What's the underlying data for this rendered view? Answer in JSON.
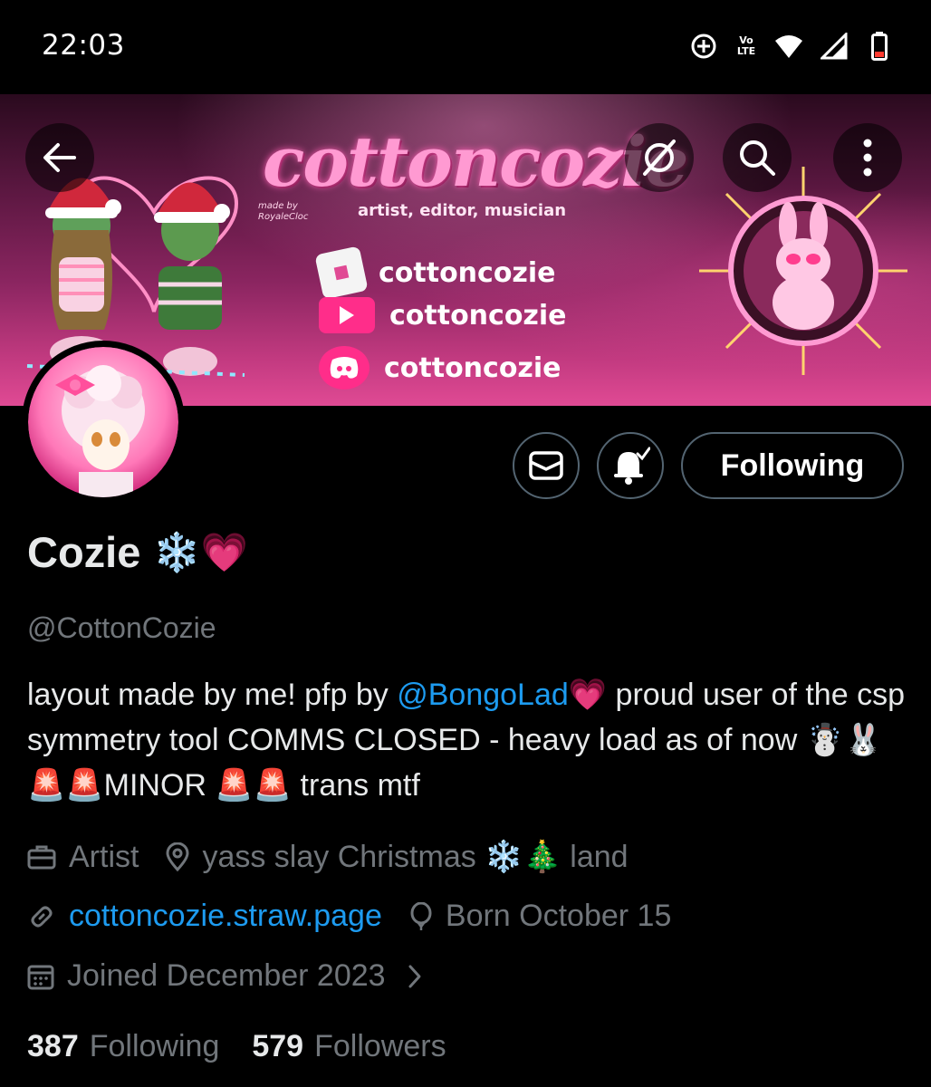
{
  "status_bar": {
    "time": "22:03",
    "icons": [
      "data-saver-icon",
      "volte-icon",
      "wifi-icon",
      "signal-icon",
      "battery-icon"
    ],
    "volte_label": "Vo LTE"
  },
  "banner": {
    "title": "cottoncozie",
    "subtitle": "artist, editor, musician",
    "credit": "made by RoyaleCloc",
    "socials": [
      {
        "icon": "roblox-icon",
        "label": "cottoncozie",
        "color": "#f4f4f4"
      },
      {
        "icon": "youtube-icon",
        "label": "cottoncozie",
        "color": "#ff2d8a"
      },
      {
        "icon": "discord-icon",
        "label": "cottoncozie",
        "color": "#ff2d8a"
      }
    ]
  },
  "nav": {
    "back": "back-arrow-icon",
    "grok": "grok-icon",
    "search": "search-icon",
    "more": "more-vertical-icon"
  },
  "actions": {
    "message_icon": "envelope-icon",
    "notify_icon": "bell-check-icon",
    "follow_label": "Following"
  },
  "profile": {
    "name": "Cozie",
    "name_emoji": "❄️💗",
    "handle": "@CottonCozie",
    "bio_part1": "layout made by me! pfp by ",
    "bio_mention": "@BongoLad",
    "bio_part2": "💗 proud user of the csp symmetry tool COMMS CLOSED - heavy load as of now ☃️🐰 🚨🚨MINOR 🚨🚨 trans mtf",
    "profession": "Artist",
    "location": "yass slay Christmas ❄️🎄 land",
    "website": "cottoncozie.straw.page",
    "birthday": "Born October 15",
    "joined": "Joined December 2023"
  },
  "stats": {
    "following_count": "387",
    "following_label": "Following",
    "followers_count": "579",
    "followers_label": "Followers"
  },
  "colors": {
    "accent_link": "#1d9bf0",
    "secondary_text": "#71767b",
    "banner_pink": "#e04a94"
  }
}
